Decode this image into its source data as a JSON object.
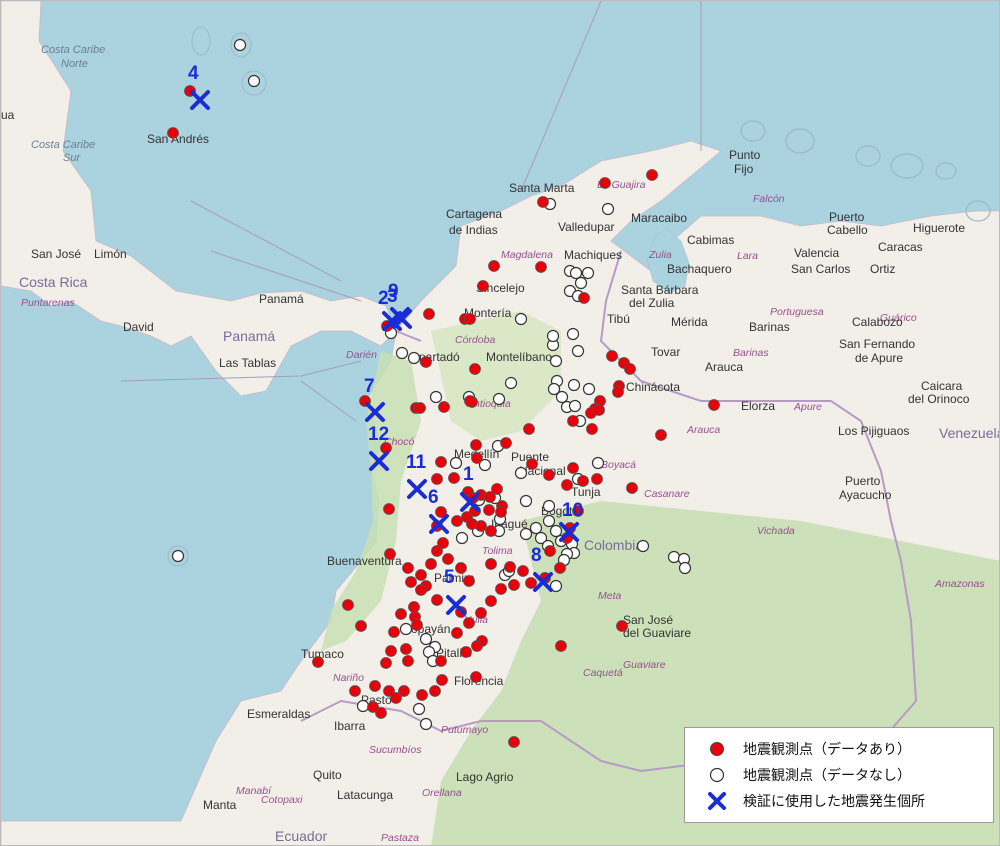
{
  "map": {
    "place_labels": [
      {
        "text": "Costa Caribe",
        "cls": "sea"
      },
      {
        "text": "Norte",
        "cls": "sea"
      },
      {
        "text": "Costa Caribe",
        "cls": "sea"
      },
      {
        "text": "Sur",
        "cls": "sea"
      },
      {
        "text": "ua",
        "cls": "place"
      },
      {
        "text": "San Andrés",
        "cls": "place"
      },
      {
        "text": "San José",
        "cls": "place"
      },
      {
        "text": "Limón",
        "cls": "place"
      },
      {
        "text": "Costa Rica",
        "cls": "country"
      },
      {
        "text": "Puntarenas",
        "cls": "region"
      },
      {
        "text": "Panamá",
        "cls": "place"
      },
      {
        "text": "David",
        "cls": "place"
      },
      {
        "text": "Panamá",
        "cls": "country"
      },
      {
        "text": "Las Tablas",
        "cls": "place"
      },
      {
        "text": "Darién",
        "cls": "region"
      },
      {
        "text": "Santa Marta",
        "cls": "place"
      },
      {
        "text": "La Guajira",
        "cls": "region"
      },
      {
        "text": "Punto",
        "cls": "place"
      },
      {
        "text": "Fijo",
        "cls": "place"
      },
      {
        "text": "Falcón",
        "cls": "region"
      },
      {
        "text": "Cartagena",
        "cls": "place"
      },
      {
        "text": "de Indias",
        "cls": "place"
      },
      {
        "text": "Valledupar",
        "cls": "place"
      },
      {
        "text": "Maracaibo",
        "cls": "place"
      },
      {
        "text": "Puerto",
        "cls": "place"
      },
      {
        "text": "Cabello",
        "cls": "place"
      },
      {
        "text": "Higuerote",
        "cls": "place"
      },
      {
        "text": "Magdalena",
        "cls": "region"
      },
      {
        "text": "Cabimas",
        "cls": "place"
      },
      {
        "text": "Valencia",
        "cls": "place"
      },
      {
        "text": "Caracas",
        "cls": "place"
      },
      {
        "text": "Zulia",
        "cls": "region"
      },
      {
        "text": "Lara",
        "cls": "region"
      },
      {
        "text": "San Carlos",
        "cls": "place"
      },
      {
        "text": "Ortiz",
        "cls": "place"
      },
      {
        "text": "Machiques",
        "cls": "place"
      },
      {
        "text": "Bachaquero",
        "cls": "place"
      },
      {
        "text": "Sincelejo",
        "cls": "place"
      },
      {
        "text": "Montería",
        "cls": "place"
      },
      {
        "text": "Santa Bárbara",
        "cls": "place"
      },
      {
        "text": "del Zulia",
        "cls": "place"
      },
      {
        "text": "Portuguesa",
        "cls": "region"
      },
      {
        "text": "Guárico",
        "cls": "region"
      },
      {
        "text": "Tibú",
        "cls": "place"
      },
      {
        "text": "Mérida",
        "cls": "place"
      },
      {
        "text": "Barinas",
        "cls": "place"
      },
      {
        "text": "Calabozo",
        "cls": "place"
      },
      {
        "text": "Córdoba",
        "cls": "region"
      },
      {
        "text": "Apartadó",
        "cls": "place"
      },
      {
        "text": "Montelíbano",
        "cls": "place"
      },
      {
        "text": "Tovar",
        "cls": "place"
      },
      {
        "text": "San Fernando",
        "cls": "place"
      },
      {
        "text": "de Apure",
        "cls": "place"
      },
      {
        "text": "Barinas",
        "cls": "region"
      },
      {
        "text": "Chinácota",
        "cls": "place"
      },
      {
        "text": "Arauca",
        "cls": "place"
      },
      {
        "text": "Elorza",
        "cls": "place"
      },
      {
        "text": "Apure",
        "cls": "region"
      },
      {
        "text": "Caicara",
        "cls": "place"
      },
      {
        "text": "del Orinoco",
        "cls": "place"
      },
      {
        "text": "Antioquia",
        "cls": "region"
      },
      {
        "text": "Arauca",
        "cls": "region"
      },
      {
        "text": "Los Pijiguaos",
        "cls": "place"
      },
      {
        "text": "Venezuela",
        "cls": "country"
      },
      {
        "text": "Chocó",
        "cls": "region"
      },
      {
        "text": "Medellín",
        "cls": "place"
      },
      {
        "text": "Puente",
        "cls": "place"
      },
      {
        "text": "Nacional",
        "cls": "place"
      },
      {
        "text": "Boyacá",
        "cls": "region"
      },
      {
        "text": "Casanare",
        "cls": "region"
      },
      {
        "text": "Puerto",
        "cls": "place"
      },
      {
        "text": "Ayacucho",
        "cls": "place"
      },
      {
        "text": "Tunja",
        "cls": "place"
      },
      {
        "text": "Bogotá",
        "cls": "place"
      },
      {
        "text": "Colombia",
        "cls": "country"
      },
      {
        "text": "Vichada",
        "cls": "region"
      },
      {
        "text": "Ibagué",
        "cls": "place"
      },
      {
        "text": "Tolima",
        "cls": "region"
      },
      {
        "text": "Buenaventura",
        "cls": "place"
      },
      {
        "text": "Meta",
        "cls": "region"
      },
      {
        "text": "Amazonas",
        "cls": "region"
      },
      {
        "text": "Palmira",
        "cls": "place"
      },
      {
        "text": "Huila",
        "cls": "region"
      },
      {
        "text": "San José",
        "cls": "place"
      },
      {
        "text": "del Guaviare",
        "cls": "place"
      },
      {
        "text": "Popayán",
        "cls": "place"
      },
      {
        "text": "Tumaco",
        "cls": "place"
      },
      {
        "text": "Pitalito",
        "cls": "place"
      },
      {
        "text": "Guaviare",
        "cls": "region"
      },
      {
        "text": "Nariño",
        "cls": "region"
      },
      {
        "text": "Florencia",
        "cls": "place"
      },
      {
        "text": "Pasto",
        "cls": "place"
      },
      {
        "text": "Caquetá",
        "cls": "region"
      },
      {
        "text": "Esmeraldas",
        "cls": "place"
      },
      {
        "text": "Ibarra",
        "cls": "place"
      },
      {
        "text": "Putumayo",
        "cls": "region"
      },
      {
        "text": "Sucumbíos",
        "cls": "region"
      },
      {
        "text": "Quito",
        "cls": "place"
      },
      {
        "text": "Lago Agrio",
        "cls": "place"
      },
      {
        "text": "Latacunga",
        "cls": "place"
      },
      {
        "text": "Manta",
        "cls": "place"
      },
      {
        "text": "Orellana",
        "cls": "region"
      },
      {
        "text": "Manabí",
        "cls": "region"
      },
      {
        "text": "Ecuador",
        "cls": "country"
      },
      {
        "text": "Pastaza",
        "cls": "region"
      },
      {
        "text": "Cotopaxi",
        "cls": "region"
      }
    ],
    "quake_sites": [
      "1",
      "2",
      "3",
      "4",
      "5",
      "6",
      "7",
      "8",
      "9",
      "10",
      "11",
      "12"
    ]
  },
  "legend": {
    "items": [
      {
        "label": "地震観測点（データあり）",
        "symbol": "red-filled-circle"
      },
      {
        "label": "地震観測点（データなし）",
        "symbol": "white-open-circle"
      },
      {
        "label": "検証に使用した地震発生個所",
        "symbol": "blue-x"
      }
    ]
  },
  "colors": {
    "sea": "#aad3df",
    "land": "#f2efe9",
    "forest": "#c8dfb4",
    "station_with_data": "#e8000b",
    "station_no_data": "#ffffff",
    "epicenter": "#1a2cd6",
    "label_number": "#1a2cd6"
  }
}
